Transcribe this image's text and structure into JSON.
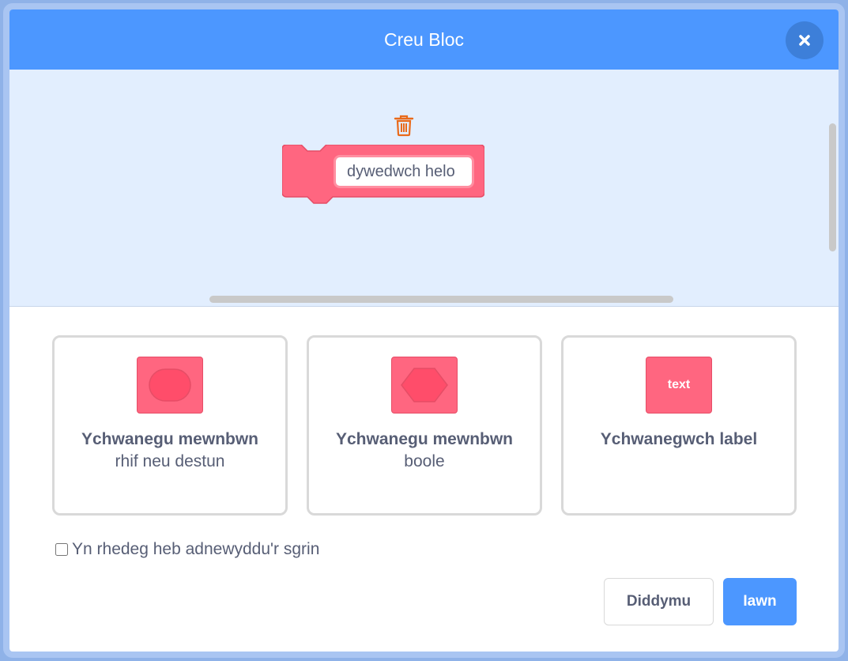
{
  "dialog": {
    "title": "Creu Bloc",
    "close_icon": "close-icon"
  },
  "workspace": {
    "block_name_value": "dywedwch helo",
    "block_color": "#ff6680",
    "trash_icon": "trash-icon"
  },
  "options": [
    {
      "title": "Ychwanegu mewnbwn",
      "subtitle": "rhif neu destun",
      "icon": "round-input-icon"
    },
    {
      "title": "Ychwanegu mewnbwn",
      "subtitle": "boole",
      "icon": "boolean-input-icon"
    },
    {
      "title": "Ychwanegwch label",
      "subtitle": "",
      "icon": "label-icon",
      "icon_text": "text"
    }
  ],
  "run_without_refresh": {
    "label": "Yn rhedeg heb adnewyddu'r sgrin",
    "checked": false
  },
  "buttons": {
    "cancel_label": "Diddymu",
    "ok_label": "Iawn"
  },
  "colors": {
    "accent": "#4c97ff",
    "block": "#ff6680",
    "text": "#575e75"
  }
}
